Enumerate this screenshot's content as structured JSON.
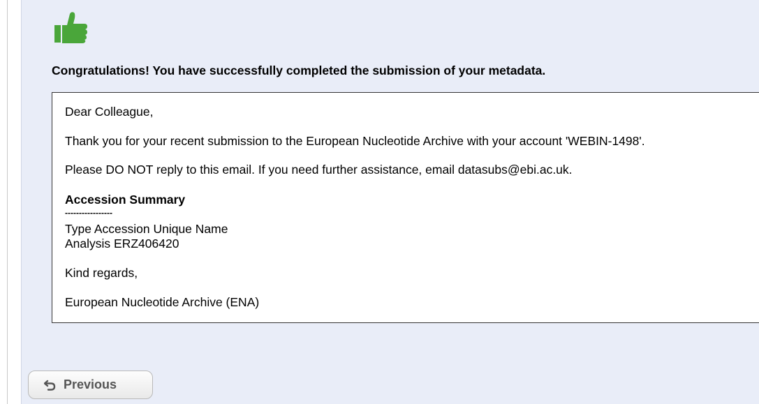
{
  "icons": {
    "success": "thumbs-up-icon",
    "previous": "undo-arrow-icon"
  },
  "colors": {
    "panel_background": "#e9edf8",
    "thumb_green": "#4aa63a"
  },
  "main": {
    "congrats_text": "Congratulations! You have successfully completed the submission of your metadata."
  },
  "message": {
    "greeting": "Dear Colleague,",
    "thanks": "Thank you for your recent submission to the European Nucleotide Archive with your account 'WEBIN-1498'.",
    "notice": "Please DO NOT reply to this email. If you need further assistance, email datasubs@ebi.ac.uk.",
    "summary_title": "Accession Summary",
    "summary_divider": "-----------------",
    "summary_header": "Type Accession Unique Name",
    "summary_row": "Analysis ERZ406420",
    "closing": "Kind regards,",
    "signature": "European Nucleotide Archive (ENA)"
  },
  "footer": {
    "previous_label": "Previous"
  }
}
